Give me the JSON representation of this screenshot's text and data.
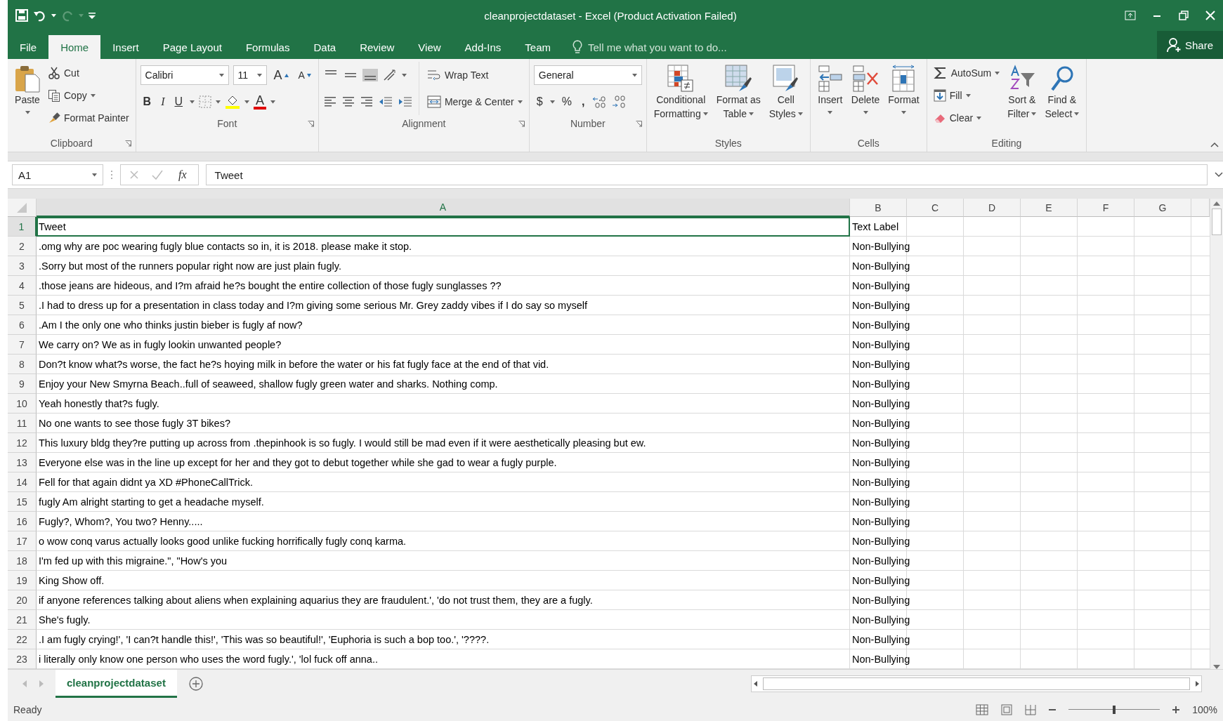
{
  "window": {
    "title": "cleanprojectdataset - Excel (Product Activation Failed)"
  },
  "tabs": [
    {
      "label": "File",
      "selected": false
    },
    {
      "label": "Home",
      "selected": true
    },
    {
      "label": "Insert",
      "selected": false
    },
    {
      "label": "Page Layout",
      "selected": false
    },
    {
      "label": "Formulas",
      "selected": false
    },
    {
      "label": "Data",
      "selected": false
    },
    {
      "label": "Review",
      "selected": false
    },
    {
      "label": "View",
      "selected": false
    },
    {
      "label": "Add-Ins",
      "selected": false
    },
    {
      "label": "Team",
      "selected": false
    }
  ],
  "tell_me": {
    "placeholder": "Tell me what you want to do..."
  },
  "share": "Share",
  "ribbon": [
    {
      "kind": "buttons",
      "label": "Clipboard",
      "launcher": true,
      "items": [
        {
          "kind": "large",
          "lines": [
            "Paste"
          ],
          "dropdown": true
        },
        {
          "kind": "small",
          "label": "Cut",
          "dropdown": false
        },
        {
          "kind": "small",
          "label": "Copy",
          "dropdown": true
        },
        {
          "kind": "small",
          "label": "Format Painter",
          "dropdown": false
        }
      ]
    },
    {
      "kind": "font",
      "label": "Font",
      "launcher": true,
      "font_name": "Calibri",
      "font_size": "11",
      "grow": "A",
      "shrink": "A",
      "bold": "B",
      "italic": "I",
      "underline": "U",
      "font_color": "A"
    },
    {
      "kind": "alignment",
      "label": "Alignment",
      "launcher": true,
      "wrap": "Wrap Text",
      "merge": "Merge & Center",
      "vertical_align": [
        {
          "selected": false
        },
        {
          "selected": false
        },
        {
          "selected": true
        }
      ]
    },
    {
      "kind": "number",
      "label": "Number",
      "launcher": true,
      "format": "General",
      "currency": "$",
      "percent": "%",
      "comma": ","
    },
    {
      "kind": "buttons",
      "label": "Styles",
      "launcher": false,
      "items": [
        {
          "kind": "large",
          "lines": [
            "Conditional",
            "Formatting"
          ],
          "dropdown": true
        },
        {
          "kind": "large",
          "lines": [
            "Format as",
            "Table"
          ],
          "dropdown": true
        },
        {
          "kind": "large",
          "lines": [
            "Cell",
            "Styles"
          ],
          "dropdown": true
        }
      ]
    },
    {
      "kind": "buttons",
      "label": "Cells",
      "launcher": false,
      "items": [
        {
          "kind": "large",
          "lines": [
            "Insert"
          ],
          "dropdown": true
        },
        {
          "kind": "large",
          "lines": [
            "Delete"
          ],
          "dropdown": true
        },
        {
          "kind": "large",
          "lines": [
            "Format"
          ],
          "dropdown": true
        }
      ]
    },
    {
      "kind": "buttons",
      "label": "Editing",
      "launcher": false,
      "items": [
        {
          "kind": "small",
          "label": "AutoSum",
          "dropdown": true
        },
        {
          "kind": "small",
          "label": "Fill",
          "dropdown": true
        },
        {
          "kind": "small",
          "label": "Clear",
          "dropdown": true
        },
        {
          "kind": "large",
          "lines": [
            "Sort &",
            "Filter"
          ],
          "dropdown": true
        },
        {
          "kind": "large",
          "lines": [
            "Find &",
            "Select"
          ],
          "dropdown": true
        }
      ]
    }
  ],
  "formula_bar": {
    "name_box": "A1",
    "function_label": "fx",
    "value": "Tweet"
  },
  "columns": [
    {
      "label": "A",
      "selected": true
    },
    {
      "label": "B",
      "selected": false
    },
    {
      "label": "C",
      "selected": false
    },
    {
      "label": "D",
      "selected": false
    },
    {
      "label": "E",
      "selected": false
    },
    {
      "label": "F",
      "selected": false
    },
    {
      "label": "G",
      "selected": false
    }
  ],
  "rows": [
    {
      "number": "1",
      "selected": true,
      "cells": [
        "Tweet",
        "Text Label"
      ]
    },
    {
      "number": "2",
      "selected": false,
      "cells": [
        ".omg why are poc wearing fugly blue contacts so in, it is 2018. please make it stop.",
        "Non-Bullying"
      ]
    },
    {
      "number": "3",
      "selected": false,
      "cells": [
        ".Sorry but most of the runners popular right now are just plain fugly.",
        "Non-Bullying"
      ]
    },
    {
      "number": "4",
      "selected": false,
      "cells": [
        ".those jeans are hideous, and I?m afraid he?s bought the entire collection of those fugly sunglasses ??",
        "Non-Bullying"
      ]
    },
    {
      "number": "5",
      "selected": false,
      "cells": [
        ".I had to dress up for a presentation in class today and I?m giving some serious Mr. Grey zaddy vibes if I do say so myself",
        "Non-Bullying"
      ]
    },
    {
      "number": "6",
      "selected": false,
      "cells": [
        ".Am I the only one who thinks justin bieber is fugly af now?",
        "Non-Bullying"
      ]
    },
    {
      "number": "7",
      "selected": false,
      "cells": [
        "We carry on? We as in fugly lookin unwanted people?",
        "Non-Bullying"
      ]
    },
    {
      "number": "8",
      "selected": false,
      "cells": [
        "Don?t know what?s worse, the fact he?s hoying milk in before the water or his fat fugly face at the end of that vid.",
        "Non-Bullying"
      ]
    },
    {
      "number": "9",
      "selected": false,
      "cells": [
        " Enjoy your New Smyrna Beach..full of seaweed, shallow fugly green water and sharks. Nothing comp.",
        "Non-Bullying"
      ]
    },
    {
      "number": "10",
      "selected": false,
      "cells": [
        "Yeah honestly that?s fugly.",
        "Non-Bullying"
      ]
    },
    {
      "number": "11",
      "selected": false,
      "cells": [
        "No one wants to see those fugly 3T bikes?",
        "Non-Bullying"
      ]
    },
    {
      "number": "12",
      "selected": false,
      "cells": [
        "This luxury bldg they?re putting up across from .thepinhook is so fugly. I would still be mad even if it were aesthetically pleasing but ew.",
        "Non-Bullying"
      ]
    },
    {
      "number": "13",
      "selected": false,
      "cells": [
        "Everyone else was in the line up except for her and they got to debut together while she gad to wear a fugly purple.",
        "Non-Bullying"
      ]
    },
    {
      "number": "14",
      "selected": false,
      "cells": [
        "Fell for that again didnt ya XD #PhoneCallTrick.",
        "Non-Bullying"
      ]
    },
    {
      "number": "15",
      "selected": false,
      "cells": [
        "fugly Am alright starting to get a headache myself.",
        "Non-Bullying"
      ]
    },
    {
      "number": "16",
      "selected": false,
      "cells": [
        "Fugly?, Whom?, You two? Henny.....",
        "Non-Bullying"
      ]
    },
    {
      "number": "17",
      "selected": false,
      "cells": [
        "o wow conq varus actually looks good unlike fucking horrifically fugly conq karma.",
        "Non-Bullying"
      ]
    },
    {
      "number": "18",
      "selected": false,
      "cells": [
        "I'm fed up with this migraine.\", \"How's you",
        "Non-Bullying"
      ]
    },
    {
      "number": "19",
      "selected": false,
      "cells": [
        "King Show off.",
        "Non-Bullying"
      ]
    },
    {
      "number": "20",
      "selected": false,
      "cells": [
        "if anyone references talking about aliens when explaining aquarius they are fraudulent.', 'do not trust them, they are a fugly.",
        "Non-Bullying"
      ]
    },
    {
      "number": "21",
      "selected": false,
      "cells": [
        "She's fugly.",
        "Non-Bullying"
      ]
    },
    {
      "number": "22",
      "selected": false,
      "cells": [
        ".I am fugly crying!', 'I can?t handle this!', 'This was so beautiful!', 'Euphoria is such a bop too.', '????.",
        "Non-Bullying"
      ]
    },
    {
      "number": "23",
      "selected": false,
      "cells": [
        "i literally only know one person who uses the word fugly.', 'lol fuck off anna..",
        "Non-Bullying"
      ]
    }
  ],
  "sheets": [
    {
      "label": "cleanprojectdataset",
      "selected": true
    }
  ],
  "status_bar": {
    "status": "Ready",
    "zoom": {
      "level": 0.5,
      "reading": "100%"
    }
  }
}
